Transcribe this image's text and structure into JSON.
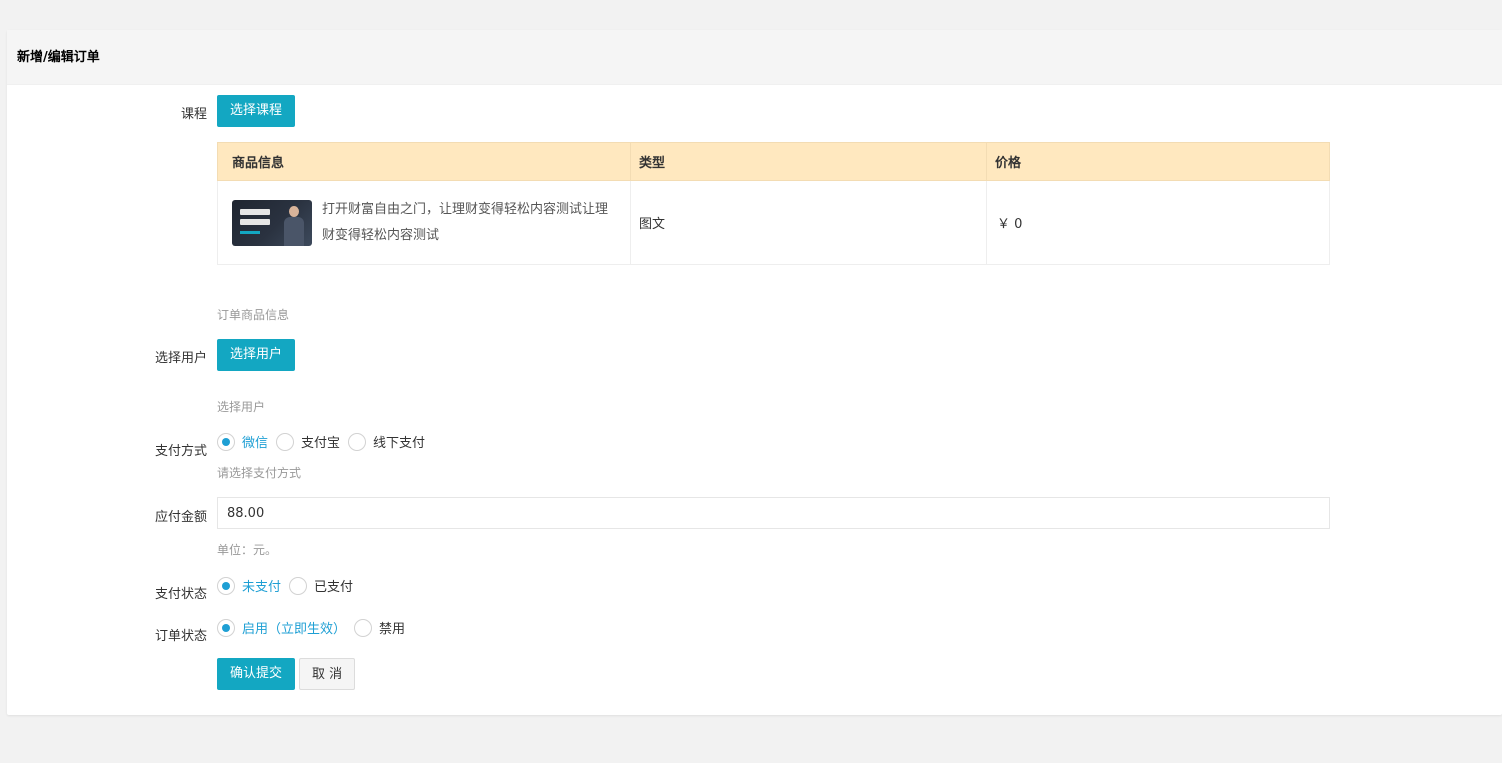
{
  "page": {
    "title": "新增/编辑订单"
  },
  "course": {
    "label": "课程",
    "button": "选择课程",
    "table": {
      "headers": [
        "商品信息",
        "类型",
        "价格"
      ],
      "rows": [
        {
          "name": "打开财富自由之门，让理财变得轻松内容测试让理财变得轻松内容测试",
          "type": "图文",
          "price": "￥ 0"
        }
      ]
    },
    "help": "订单商品信息"
  },
  "user": {
    "label": "选择用户",
    "button": "选择用户",
    "help": "选择用户"
  },
  "payment": {
    "label": "支付方式",
    "options": [
      "微信",
      "支付宝",
      "线下支付"
    ],
    "selected": "微信",
    "help": "请选择支付方式"
  },
  "amount": {
    "label": "应付金额",
    "value": "88.00",
    "help": "单位：元。"
  },
  "pay_status": {
    "label": "支付状态",
    "options": [
      "未支付",
      "已支付"
    ],
    "selected": "未支付"
  },
  "order_status": {
    "label": "订单状态",
    "options": [
      "启用（立即生效）",
      "禁用"
    ],
    "selected": "启用（立即生效）"
  },
  "actions": {
    "submit": "确认提交",
    "cancel": "取 消"
  },
  "colors": {
    "primary_button": "#13a7c2",
    "radio_accent": "#1e9fd4",
    "table_header": "#ffe8bf"
  }
}
